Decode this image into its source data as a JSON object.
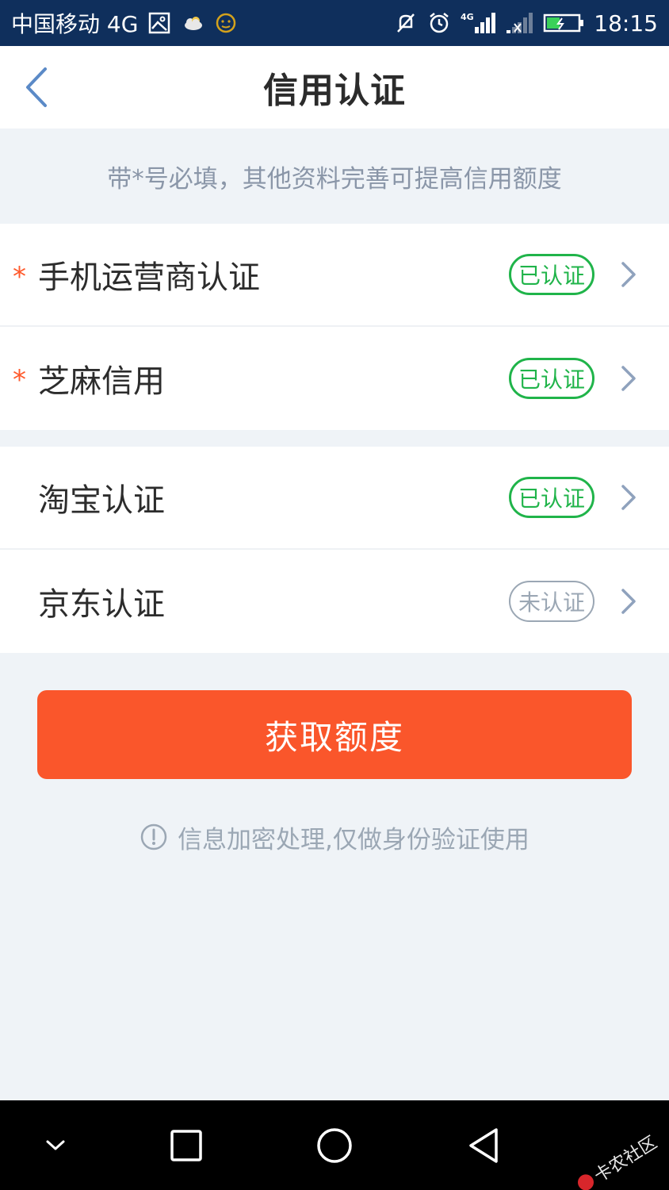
{
  "status_bar": {
    "carrier": "中国移动 4G",
    "network_label": "4G",
    "time": "18:15",
    "icons": [
      "image-icon",
      "cloud-icon",
      "face-icon",
      "mute-icon",
      "alarm-icon",
      "signal-icon",
      "signal-weak-icon",
      "battery-icon"
    ]
  },
  "header": {
    "title": "信用认证",
    "back_icon": "chevron-left-icon"
  },
  "tip": "带*号必填，其他资料完善可提高信用额度",
  "sections": [
    {
      "items": [
        {
          "label": "手机运营商认证",
          "required": "*",
          "status": "已认证"
        },
        {
          "label": "芝麻信用",
          "required": "*",
          "status": "已认证"
        }
      ]
    },
    {
      "items": [
        {
          "label": "淘宝认证",
          "status": "已认证"
        },
        {
          "label": "京东认证",
          "status": "未认证"
        }
      ]
    }
  ],
  "submit_button": "获取额度",
  "note": "信息加密处理,仅做身份验证使用",
  "colors": {
    "accent": "#fa562b",
    "verified": "#20b44a",
    "unverified": "#9ba7b4",
    "status_bar": "#0f2f5c"
  },
  "watermark": "卡农社区"
}
